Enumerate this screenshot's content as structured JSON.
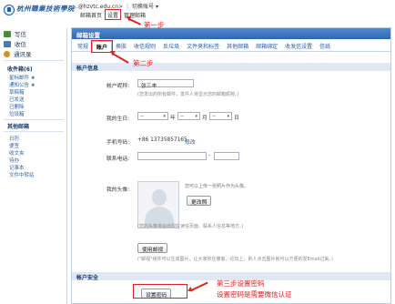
{
  "header": {
    "logo_text": "杭州職業技術學院",
    "account_email": "...@hzvtc.edu.cn>",
    "account_sep": "|",
    "switch_account": "切换账号",
    "nav": [
      "邮箱首页",
      "设置",
      "管理邮箱"
    ]
  },
  "sidebar": {
    "quick": [
      {
        "label": "写信",
        "icon": "write-icon"
      },
      {
        "label": "收信",
        "icon": "inbox-icon"
      },
      {
        "label": "通讯录",
        "icon": "contacts-icon"
      }
    ],
    "folders_title": "收件箱(6)",
    "folders": [
      "星标邮件 ★",
      "通知公告 ★",
      "草稿箱",
      "已发送",
      "已删除",
      "垃圾箱"
    ],
    "other_title": "其他邮箱",
    "tools": [
      "日历",
      "便签",
      "收文夹",
      "待办",
      "记事本",
      "文件中转站"
    ]
  },
  "main": {
    "title": "邮箱设置",
    "tabs": [
      "常规",
      "账户",
      "换肤",
      "收信规则",
      "反垃圾",
      "文件夹和标签",
      "其他邮箱",
      "邮箱绑定",
      "收发信设置",
      "信纸"
    ],
    "active_tab_index": 1,
    "account_info_title": "帐户信息",
    "nickname_label": "帐户昵称:",
    "nickname_value": "张三丰",
    "nickname_hint": "(您发出的所有邮件，发件人将显示您的邮箱昵称。)",
    "birthday_label": "我的生日:",
    "birthday_year_unit": "年",
    "birthday_month_unit": "月",
    "birthday_day_unit": "日",
    "phone_label": "手机号码:",
    "phone_value": "+86 13735857165",
    "phone_edit": "修改",
    "tel_label": "联系电话:",
    "tel_sep": "-",
    "avatar_label": "我的头像:",
    "avatar_hint": "您可以上传一张照片作为头像。",
    "change_button": "更改照",
    "avatar_hint2": "(您的头像将会出现在读信页面、联系人信息等地方。)",
    "use_email_button": "使用邮视",
    "email_card_hint": "(\"邮视\"组件可以生成图片，让大家欣在慷客、论坛上，别人点击图片就可以方便的发Email过来。)",
    "security_title": "帐户安全",
    "set_password_button": "设置密码"
  },
  "annotations": {
    "step1": "第一步",
    "step2": "第二步",
    "step3_line1": "第三步设置密码",
    "step3_line2": "设置密码是需要微信认证"
  }
}
